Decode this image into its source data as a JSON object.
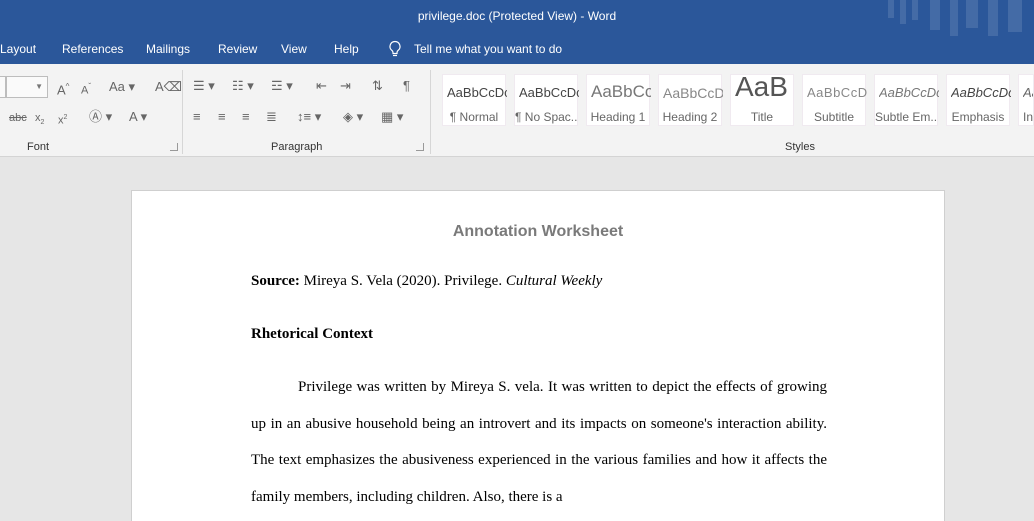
{
  "window": {
    "title": "privilege.doc (Protected View)  -  Word"
  },
  "menu": {
    "tabs": [
      "Layout",
      "References",
      "Mailings",
      "Review",
      "View",
      "Help"
    ],
    "tell_me": "Tell me what you want to do"
  },
  "ribbon": {
    "groups": {
      "font": "Font",
      "paragraph": "Paragraph",
      "styles": "Styles"
    },
    "styles": [
      {
        "sample": "AaBbCcDc",
        "name": "¶ Normal"
      },
      {
        "sample": "AaBbCcDc",
        "name": "¶ No Spac..."
      },
      {
        "sample": "AaBbCc",
        "name": "Heading 1"
      },
      {
        "sample": "AaBbCcD",
        "name": "Heading 2"
      },
      {
        "sample": "AaB",
        "name": "Title"
      },
      {
        "sample": "AaBbCcD",
        "name": "Subtitle"
      },
      {
        "sample": "AaBbCcDc",
        "name": "Subtle Em..."
      },
      {
        "sample": "AaBbCcDc",
        "name": "Emphasis"
      },
      {
        "sample": "Aa",
        "name": "In"
      }
    ]
  },
  "document": {
    "title": "Annotation Worksheet",
    "source_label": "Source:",
    "source_text": " Mireya S. Vela (2020). Privilege. ",
    "source_publication": "Cultural Weekly",
    "heading": "Rhetorical Context",
    "paragraph": "Privilege was written by Mireya S. vela. It was written to depict the effects of growing up in an abusive household being an introvert and its impacts on someone's interaction ability. The text emphasizes the abusiveness experienced in the various families and how it affects the family members, including children. Also, there is a"
  }
}
